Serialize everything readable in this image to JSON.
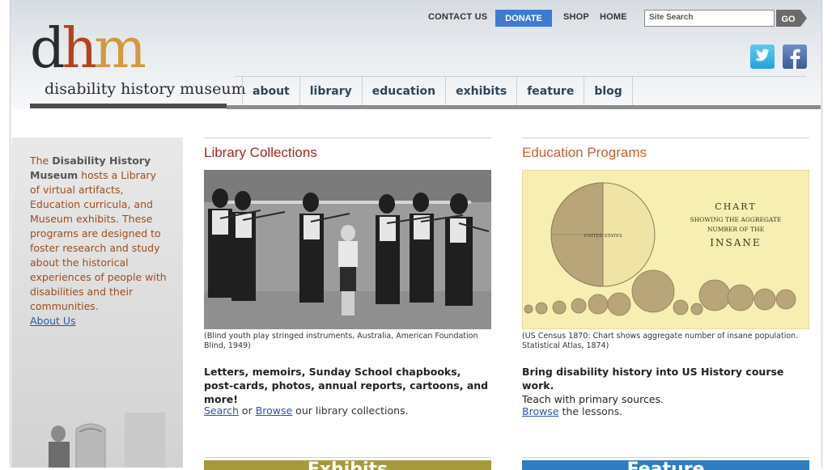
{
  "header": {
    "logo_letters": [
      "d",
      "h",
      "m"
    ],
    "logo_text": "disability history museum",
    "utility_nav": {
      "contact": "CONTACT US",
      "donate": "DONATE",
      "shop": "SHOP",
      "home": "HOME"
    },
    "search": {
      "placeholder": "Site Search",
      "go_label": "GO"
    },
    "main_nav": [
      "about",
      "library",
      "education",
      "exhibits",
      "feature",
      "blog"
    ]
  },
  "sidebar": {
    "text_prefix": "The ",
    "bold_name": "Disability History Museum",
    "text_body": " hosts a Library of virtual artifacts, Education curricula, and Museum exhibits. These programs are designed to foster research and study about the historical experiences of people with disabilities and their communities.",
    "link": "About Us"
  },
  "library": {
    "title": "Library Collections",
    "caption": "(Blind youth play stringed instruments, Australia, American Foundation Blind, 1949)",
    "lead": "Letters, memoirs, Sunday School chapbooks, post-cards, photos, annual reports, cartoons, and more!",
    "search_link": "Search",
    "or_text": " or ",
    "browse_link": "Browse",
    "tail_text": " our library collections.",
    "banner": "Exhibits"
  },
  "education": {
    "title": "Education Programs",
    "chart_title_1": "CHART",
    "chart_title_2": "SHOWING THE AGGREGATE",
    "chart_title_3": "NUMBER OF THE",
    "chart_title_4": "INSANE",
    "chart_label_us": "UNITED STATES",
    "caption": "(US Census 1870: Chart shows aggregate number of insane population. Statistical Atlas, 1874)",
    "lead_bold": "Bring disability history into US History course work.",
    "lead_plain": "Teach with primary sources.",
    "browse_link": "Browse",
    "tail_text": " the lessons.",
    "banner": "Feature"
  },
  "colors": {
    "donate_blue": "#3e79d6",
    "library_title": "#a1271c",
    "education_title": "#c7612b",
    "link_blue": "#2a55a6",
    "sidebar_text": "#9c4e1e"
  }
}
